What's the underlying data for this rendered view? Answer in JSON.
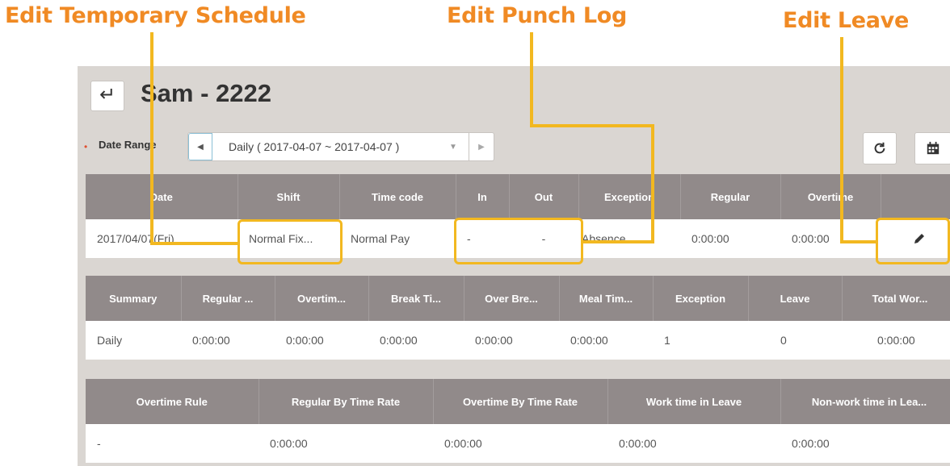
{
  "callouts": {
    "temp_schedule": "Edit Temporary Schedule",
    "punch_log": "Edit Punch Log",
    "leave": "Edit Leave"
  },
  "header": {
    "employee": "Sam - 2222"
  },
  "date_range": {
    "label": "Date Range",
    "value": "Daily ( 2017-04-07 ~ 2017-04-07 )"
  },
  "colors": {
    "callout": "#f08a24",
    "highlight": "#f2b820",
    "header_bg": "#918a8a",
    "panel_bg": "#dad6d2"
  },
  "icons": [
    "back-arrow-icon",
    "chevron-left-icon",
    "caret-down-icon",
    "chevron-right-icon",
    "refresh-icon",
    "calendar-icon",
    "pencil-icon"
  ],
  "attendance": {
    "headers": [
      "Date",
      "Shift",
      "Time code",
      "In",
      "Out",
      "Exception",
      "Regular",
      "Overtime",
      ""
    ],
    "row": [
      "2017/04/07(Fri)",
      "Normal Fix...",
      "Normal Pay",
      "-",
      "-",
      "Absence",
      "0:00:00",
      "0:00:00"
    ]
  },
  "summary": {
    "headers": [
      "Summary",
      "Regular ...",
      "Overtim...",
      "Break Ti...",
      "Over Bre...",
      "Meal Tim...",
      "Exception",
      "Leave",
      "Total Wor..."
    ],
    "row": [
      "Daily",
      "0:00:00",
      "0:00:00",
      "0:00:00",
      "0:00:00",
      "0:00:00",
      "1",
      "0",
      "0:00:00"
    ]
  },
  "overtime": {
    "headers": [
      "Overtime Rule",
      "Regular By Time Rate",
      "Overtime By Time Rate",
      "Work time in Leave",
      "Non-work time in Lea..."
    ],
    "row": [
      "-",
      "0:00:00",
      "0:00:00",
      "0:00:00",
      "0:00:00"
    ]
  }
}
